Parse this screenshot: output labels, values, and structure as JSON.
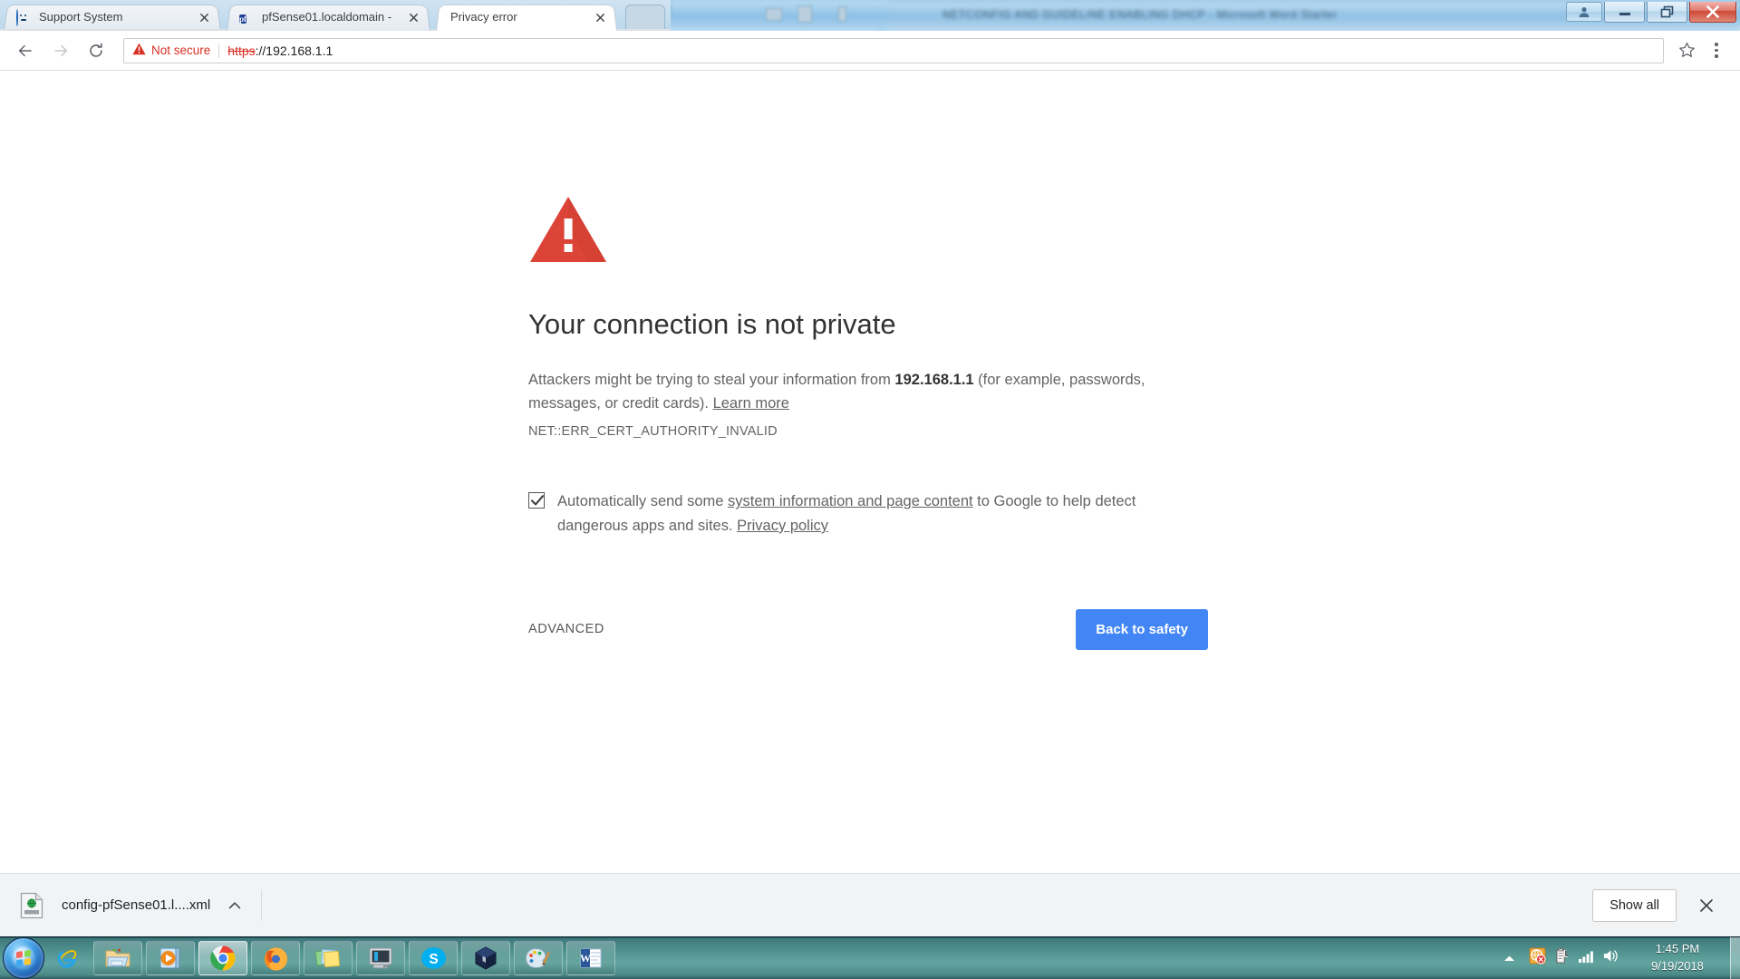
{
  "window": {
    "controls": [
      {
        "name": "user-account-button",
        "glyph": "user"
      },
      {
        "name": "minimize-button",
        "glyph": "minimize"
      },
      {
        "name": "restore-button",
        "glyph": "restore"
      },
      {
        "name": "close-button",
        "glyph": "close"
      }
    ]
  },
  "background_window": {
    "title_blurred": "NETCONFIG AND GUIDELINE ENABLING DHCP - Microsoft Word Starter"
  },
  "browser": {
    "tabs": [
      {
        "title": "Support System",
        "favicon": "support-avatar-icon",
        "active": false
      },
      {
        "title": "pfSense01.localdomain -",
        "favicon": "pfsense-icon",
        "active": false
      },
      {
        "title": "Privacy error",
        "favicon": "none",
        "active": true
      }
    ],
    "new_tab_label": "+",
    "toolbar": {
      "back_label": "Back",
      "forward_label": "Forward",
      "reload_label": "Reload",
      "security_status": "Not secure",
      "url_scheme": "https",
      "url_rest": "://192.168.1.1",
      "url_full": "https://192.168.1.1",
      "bookmark_label": "Bookmark this page",
      "menu_label": "Customize and control Google Chrome"
    }
  },
  "interstitial": {
    "headline": "Your connection is not private",
    "paragraph_lead": "Attackers might be trying to steal your information from ",
    "host": "192.168.1.1",
    "paragraph_tail": " (for example, passwords, messages, or credit cards). ",
    "learn_more": "Learn more",
    "error_code": "NET::ERR_CERT_AUTHORITY_INVALID",
    "optin": {
      "checked": true,
      "text_before_link": "Automatically send some ",
      "link_1": "system information and page content",
      "text_middle": " to Google to help detect dangerous apps and sites. ",
      "link_2": "Privacy policy"
    },
    "advanced_label": "ADVANCED",
    "safety_button_label": "Back to safety",
    "accent_blue": "#4285f4",
    "warning_red": "#db4437"
  },
  "download_shelf": {
    "item_name": "config-pfSense01.l....xml",
    "item_icon": "xml-file-icon",
    "menu_caret": "chevron-up-icon",
    "show_all_label": "Show all",
    "close_label": "Close downloads bar"
  },
  "taskbar": {
    "start_label": "Start",
    "quick_launch": [
      {
        "name": "internet-explorer-icon",
        "label": "Internet Explorer"
      }
    ],
    "tasks": [
      {
        "name": "windows-explorer-icon",
        "label": "Windows Explorer",
        "active": false
      },
      {
        "name": "media-player-icon",
        "label": "Windows Media Player",
        "active": false
      },
      {
        "name": "google-chrome-icon",
        "label": "Google Chrome",
        "active": true
      },
      {
        "name": "mozilla-firefox-icon",
        "label": "Mozilla Firefox",
        "active": false
      },
      {
        "name": "sticky-notes-icon",
        "label": "Sticky Notes",
        "active": false
      },
      {
        "name": "computer-icon",
        "label": "Computer",
        "active": false
      },
      {
        "name": "skype-icon",
        "label": "Skype",
        "active": false
      },
      {
        "name": "virtualbox-icon",
        "label": "Oracle VM VirtualBox",
        "active": false
      },
      {
        "name": "paint-icon",
        "label": "Paint",
        "active": false
      },
      {
        "name": "microsoft-word-icon",
        "label": "Microsoft Word",
        "active": false
      }
    ],
    "tray": {
      "overflow_caret": "chevron-up-icon",
      "icons": [
        {
          "name": "network-error-icon",
          "label": "No Internet access"
        },
        {
          "name": "action-center-icon",
          "label": "Action Center"
        },
        {
          "name": "network-signal-icon",
          "label": "Network"
        },
        {
          "name": "volume-icon",
          "label": "Volume"
        }
      ],
      "time": "1:45 PM",
      "date": "9/19/2018"
    }
  }
}
